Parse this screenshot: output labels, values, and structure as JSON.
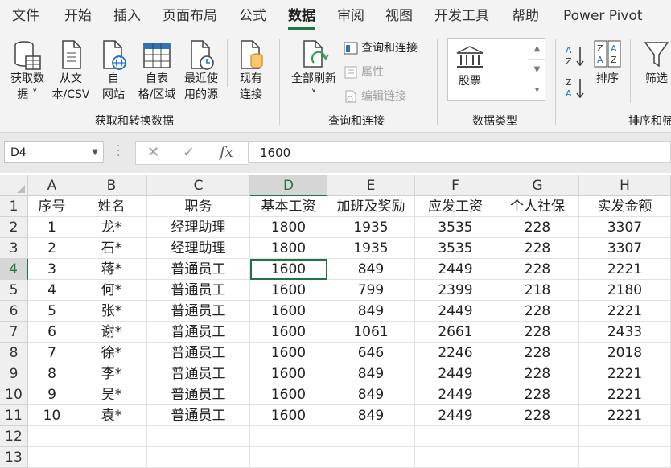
{
  "ribbon_tabs": [
    "文件",
    "开始",
    "插入",
    "页面布局",
    "公式",
    "数据",
    "审阅",
    "视图",
    "开发工具",
    "帮助",
    "Power Pivot"
  ],
  "active_tab": "数据",
  "accent_color": "#217346",
  "ribbon": {
    "get_data": {
      "line1": "获取数",
      "line2": "据 ˅",
      "icon": "database-icon"
    },
    "from_text": {
      "line1": "从文",
      "line2": "本/CSV",
      "icon": "text-file-icon"
    },
    "from_web": {
      "line1": "自",
      "line2": "网站",
      "icon": "web-icon"
    },
    "from_table": {
      "line1": "自表",
      "line2": "格/区域",
      "icon": "table-icon"
    },
    "recent_sources": {
      "line1": "最近使",
      "line2": "用的源",
      "icon": "recent-sources-icon"
    },
    "existing_conn": {
      "line1": "现有",
      "line2": "连接",
      "icon": "existing-connections-icon"
    },
    "group1_label": "获取和转换数据",
    "refresh_all": {
      "line1": "全部刷新",
      "line2": "˅",
      "icon": "refresh-icon"
    },
    "queries_conn": "查询和连接",
    "properties": "属性",
    "edit_links": "编辑链接",
    "group2_label": "查询和连接",
    "stocks": "股票",
    "group3_label": "数据类型",
    "sort_label": "排序",
    "filter_label": "筛选",
    "group4_label": "排序和筛"
  },
  "formula_bar": {
    "name_box": "D4",
    "formula": "1600",
    "fx": "fx"
  },
  "sheet": {
    "columns": [
      "A",
      "B",
      "C",
      "D",
      "E",
      "F",
      "G",
      "H"
    ],
    "row_numbers": [
      "1",
      "2",
      "3",
      "4",
      "5",
      "6",
      "7",
      "8",
      "9",
      "10",
      "11",
      "12",
      "13"
    ],
    "selected_cell": "D4",
    "rows": [
      [
        "序号",
        "姓名",
        "职务",
        "基本工资",
        "加班及奖励",
        "应发工资",
        "个人社保",
        "实发金额"
      ],
      [
        "1",
        "龙*",
        "经理助理",
        "1800",
        "1935",
        "3535",
        "228",
        "3307"
      ],
      [
        "2",
        "石*",
        "经理助理",
        "1800",
        "1935",
        "3535",
        "228",
        "3307"
      ],
      [
        "3",
        "蒋*",
        "普通员工",
        "1600",
        "849",
        "2449",
        "228",
        "2221"
      ],
      [
        "4",
        "何*",
        "普通员工",
        "1600",
        "799",
        "2399",
        "218",
        "2180"
      ],
      [
        "5",
        "张*",
        "普通员工",
        "1600",
        "849",
        "2449",
        "228",
        "2221"
      ],
      [
        "6",
        "谢*",
        "普通员工",
        "1600",
        "1061",
        "2661",
        "228",
        "2433"
      ],
      [
        "7",
        "徐*",
        "普通员工",
        "1600",
        "646",
        "2246",
        "228",
        "2018"
      ],
      [
        "8",
        "李*",
        "普通员工",
        "1600",
        "849",
        "2449",
        "228",
        "2221"
      ],
      [
        "9",
        "吴*",
        "普通员工",
        "1600",
        "849",
        "2449",
        "228",
        "2221"
      ],
      [
        "10",
        "袁*",
        "普通员工",
        "1600",
        "849",
        "2449",
        "228",
        "2221"
      ],
      [
        "",
        "",
        "",
        "",
        "",
        "",
        "",
        ""
      ],
      [
        "",
        "",
        "",
        "",
        "",
        "",
        "",
        ""
      ]
    ]
  }
}
